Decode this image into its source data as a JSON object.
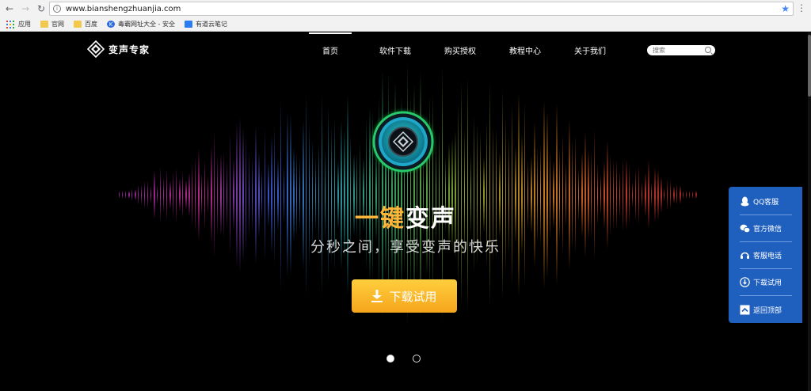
{
  "browser": {
    "url": "www.bianshengzhuanjia.com",
    "bookmarks": [
      "应用",
      "官网",
      "百度",
      "毒霸网址大全 - 安全",
      "有道云笔记"
    ]
  },
  "site": {
    "logo_text": "变声专家",
    "nav": [
      "首页",
      "软件下载",
      "购买授权",
      "教程中心",
      "关于我们"
    ],
    "active_nav": "首页",
    "search_placeholder": "搜索"
  },
  "hero": {
    "headline_accent": "一键",
    "headline_rest": "变声",
    "subline": "分秒之间，享受变声的快乐",
    "button_label": "下载试用"
  },
  "carousel": {
    "slides": 2,
    "active": 1
  },
  "side_panel": {
    "items": [
      "QQ客服",
      "官方微信",
      "客服电话",
      "下载试用",
      "返回顶部"
    ]
  },
  "colors": {
    "accent": "#ffb43a",
    "button": "#f9b52c",
    "panel": "#1f5fbe"
  }
}
